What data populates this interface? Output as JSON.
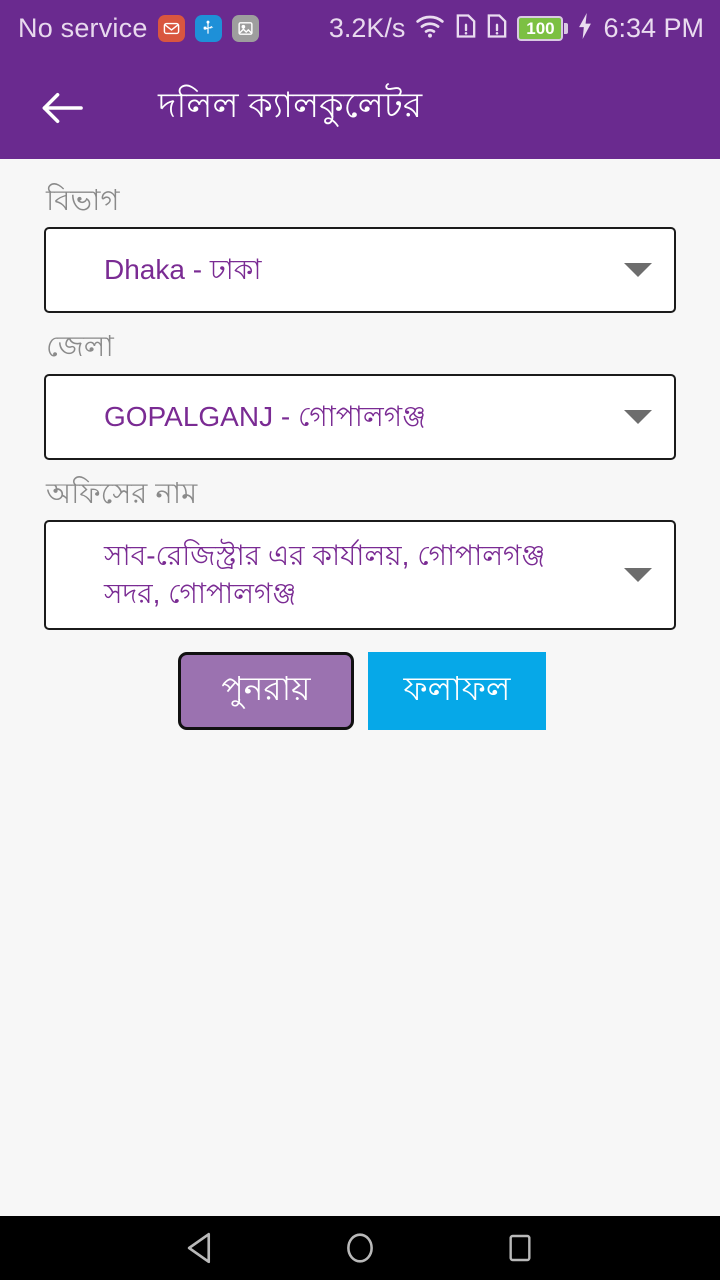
{
  "status_bar": {
    "carrier": "No service",
    "tray_icons": [
      "mail-icon",
      "usb-icon",
      "image-icon"
    ],
    "net_speed": "3.2K/s",
    "wifi": "wifi-icon",
    "sim1": "sim-card-alert-icon",
    "sim2": "sim-card-alert-icon",
    "battery_level": "100",
    "charging": "charging-bolt-icon",
    "time": "6:34 PM"
  },
  "app_bar": {
    "back_icon": "back-arrow-icon",
    "title": "দলিল ক্যালকুলেটর"
  },
  "form": {
    "fields": [
      {
        "label": "বিভাগ",
        "value": "Dhaka - ঢাকা",
        "caret": "chevron-down-icon"
      },
      {
        "label": "জেলা",
        "value": "GOPALGANJ - গোপালগঞ্জ",
        "caret": "chevron-down-icon"
      },
      {
        "label": "অফিসের নাম",
        "value": "সাব-রেজিস্ট্রার এর কার্যালয়, গোপালগঞ্জ সদর, গোপালগঞ্জ",
        "caret": "chevron-down-icon"
      }
    ],
    "buttons": {
      "reset_label": "পুনরায়",
      "result_label": "ফলাফল"
    }
  },
  "nav_bar": {
    "back": "nav-back-icon",
    "home": "nav-home-icon",
    "recents": "nav-recents-icon"
  },
  "colors": {
    "primary_purple": "#6a2a8f",
    "value_purple": "#7a2b93",
    "reset_button": "#9b72b0",
    "result_button": "#06a8e8",
    "battery_green": "#7cc043",
    "page_background": "#f7f7f7"
  }
}
